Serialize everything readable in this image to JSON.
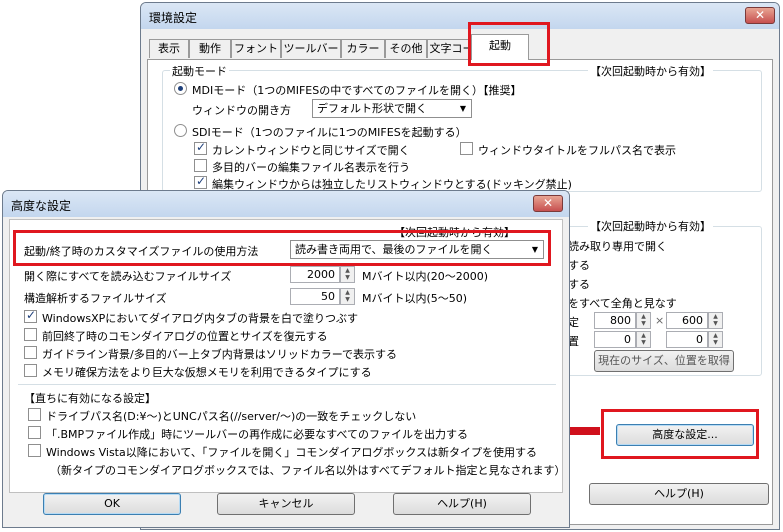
{
  "main_window": {
    "title": "環境設定",
    "close": "✕",
    "tabs": [
      "表示",
      "動作",
      "フォント",
      "ツールバー",
      "カラー",
      "その他",
      "文字コード",
      "起動"
    ],
    "startup_mode": {
      "label": "起動モード",
      "note": "【次回起動時から有効】",
      "mdi_label": "MDIモード（1つのMIFESの中ですべてのファイルを開く）【推奨】",
      "open_method_label": "ウィンドウの開き方",
      "open_method_value": "デフォルト形状で開く",
      "sdi_label": "SDIモード（1つのファイルに1つのMIFESを起動する）",
      "same_size_label": "カレントウィンドウと同じサイズで開く",
      "fullpath_label": "ウィンドウタイトルをフルパス名で表示",
      "multibar_label": "多目的バーの編集ファイル名表示を行う",
      "independent_list_label": "編集ウィンドウからは独立したリストウィンドウとする(ドッキング禁止)"
    },
    "right_partial": {
      "note": "【次回起動時から有効】",
      "line1": "読み取り専用で開く",
      "line2": "する",
      "line3": "する",
      "line4": "をすべて全角と見なす",
      "line5": "定",
      "line6": "置",
      "width_value": "800",
      "height_value": "600",
      "pos_x_value": "0",
      "pos_y_value": "0",
      "times": "×",
      "get_size_button": "現在のサイズ、位置を取得",
      "advanced_button": "高度な設定...",
      "help_button": "ヘルプ(H)"
    }
  },
  "adv_dialog": {
    "title": "高度な設定",
    "close": "✕",
    "note": "【次回起動時から有効】",
    "customize_label": "起動/終了時のカスタマイズファイルの使用方法",
    "customize_value": "読み書き両用で、最後のファイルを開く",
    "readall_label": "開く際にすべてを読み込むファイルサイズ",
    "readall_value": "2000",
    "readall_unit": "Mバイト以内(20～2000)",
    "parse_label": "構造解析するファイルサイズ",
    "parse_value": "50",
    "parse_unit": "Mバイト以内(5～50)",
    "cb_xp": "WindowsXPにおいてダイアログ内タブの背景を白で塗りつぶす",
    "cb_restore": "前回終了時のコモンダイアログの位置とサイズを復元する",
    "cb_guideline": "ガイドライン背景/多目的バー上タブ内背景はソリッドカラーで表示する",
    "cb_memory": "メモリ確保方法をより巨大な仮想メモリを利用できるタイプにする",
    "immediate_label": "【直ちに有効になる設定】",
    "cb_drive": "ドライブパス名(D:¥～)とUNCパス名(//server/～)の一致をチェックしない",
    "cb_bmp": "「.BMPファイル作成」時にツールバーの再作成に必要なすべてのファイルを出力する",
    "cb_vista": "Windows Vista以降において、「ファイルを開く」コモンダイアログボックスは新タイプを使用する",
    "vista_note": "（新タイプのコモンダイアログボックスでは、ファイル名以外はすべてデフォルト指定と見なされます）",
    "ok": "OK",
    "cancel": "キャンセル",
    "help": "ヘルプ(H)"
  },
  "arrow": "⬅",
  "colors": {
    "highlight": "#e0171f",
    "arrow": "#d0101c"
  }
}
